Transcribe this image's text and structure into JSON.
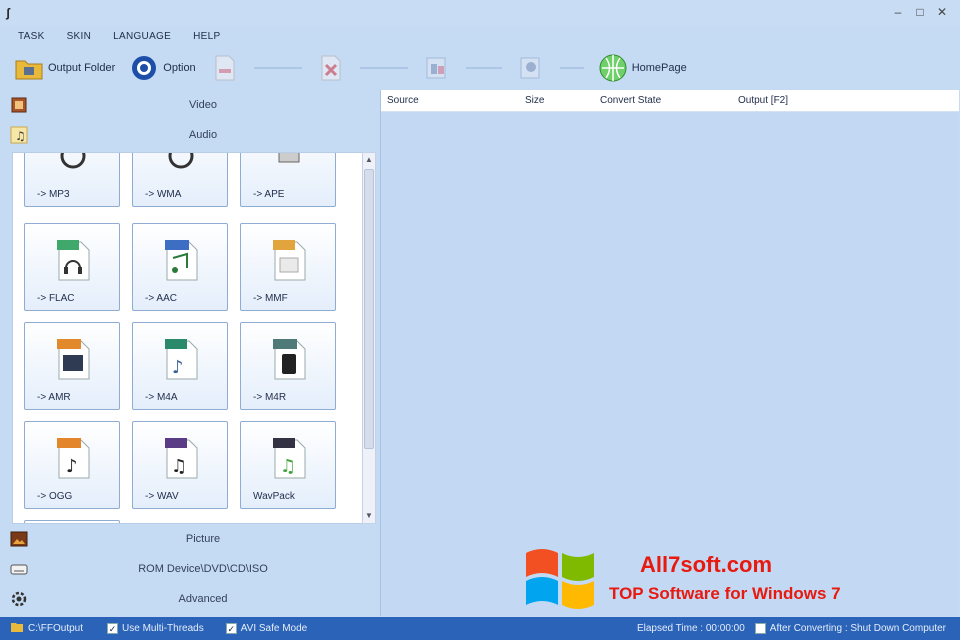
{
  "window": {
    "title": "",
    "app_icon": "app-logo-icon",
    "controls": [
      "minimize-icon",
      "maximize-icon",
      "close-icon"
    ]
  },
  "menu": [
    "TASK",
    "SKIN",
    "LANGUAGE",
    "HELP"
  ],
  "toolbar": {
    "output_folder": "Output Folder",
    "option": "Option",
    "homepage": "HomePage"
  },
  "categories_top": [
    {
      "label": "Video",
      "icon": "video-icon"
    },
    {
      "label": "Audio",
      "icon": "audio-icon"
    }
  ],
  "formats": [
    "-> MP3",
    "-> WMA",
    "-> APE",
    "-> FLAC",
    "-> AAC",
    "-> MMF",
    "-> AMR",
    "-> M4A",
    "-> M4R",
    "-> OGG",
    "-> WAV",
    "WavPack"
  ],
  "categories_bottom": [
    {
      "label": "Picture",
      "icon": "picture-icon"
    },
    {
      "label": "ROM Device\\DVD\\CD\\ISO",
      "icon": "rom-device-icon"
    },
    {
      "label": "Advanced",
      "icon": "advanced-gear-icon"
    }
  ],
  "table": {
    "columns": [
      "Source",
      "Size",
      "Convert State",
      "Output [F2]"
    ]
  },
  "watermark": {
    "title": "All7soft.com",
    "subtitle": "TOP Software for Windows 7"
  },
  "status": {
    "output": "C:\\FFOutput",
    "item2": "Use Multi-Threads",
    "item3": "AVI Safe Mode",
    "elapsed": "Elapsed Time : 00:00:00",
    "after": "After Converting : Shut Down Computer"
  },
  "colors": {
    "accent": "#2a63b8",
    "background": "#c5daf3",
    "watermark_red": "#e8190f"
  }
}
